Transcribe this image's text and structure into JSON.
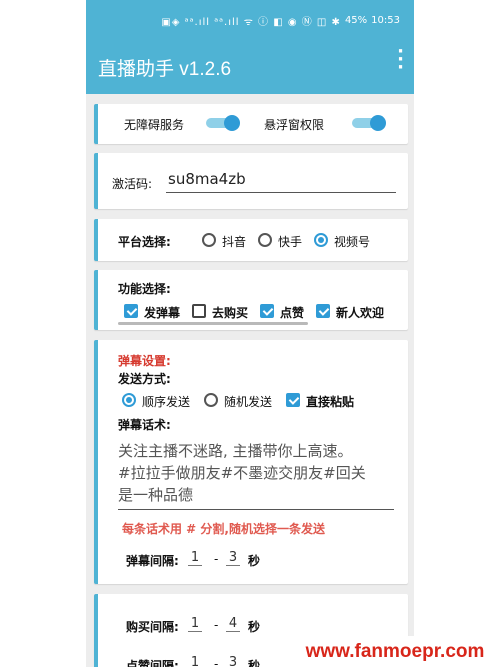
{
  "status_bar": {
    "icons": "▣◈ ᵃᵃ.ıll ᵃᵃ.ıll ᯤ ⓘ ◧ ◉ Ⓝ ◫ ✱",
    "battery": "45%",
    "time": "10:53"
  },
  "app_bar": {
    "title": "直播助手 v1.2.6",
    "menu_icon": "more-vert-icon"
  },
  "permissions": {
    "accessibility_label": "无障碍服务",
    "accessibility_on": true,
    "overlay_label": "悬浮窗权限",
    "overlay_on": true
  },
  "activation": {
    "label": "激活码:",
    "value": "su8ma4zb"
  },
  "platform": {
    "label": "平台选择:",
    "options": [
      "抖音",
      "快手",
      "视频号"
    ],
    "selected": "视频号"
  },
  "features": {
    "label": "功能选择:",
    "items": [
      {
        "label": "发弹幕",
        "checked": true
      },
      {
        "label": "去购买",
        "checked": false
      },
      {
        "label": "点赞",
        "checked": true
      },
      {
        "label": "新人欢迎",
        "checked": true
      }
    ]
  },
  "danmu": {
    "title": "弹幕设置:",
    "send_mode_label": "发送方式:",
    "modes": [
      {
        "label": "顺序发送",
        "type": "radio",
        "checked": true
      },
      {
        "label": "随机发送",
        "type": "radio",
        "checked": false
      },
      {
        "label": "直接粘贴",
        "type": "checkbox",
        "checked": true
      }
    ],
    "script_label": "弹幕话术:",
    "script_lines": [
      "关注主播不迷路, 主播带你上高速。",
      "#拉拉手做朋友#不墨迹交朋友#回关",
      "是一种品德"
    ],
    "hint": "每条话术用 # 分割,随机选择一条发送",
    "interval_label": "弹幕间隔:",
    "interval_min": "1",
    "interval_max": "3",
    "interval_unit": "秒"
  },
  "purchase": {
    "interval_label": "购买间隔:",
    "interval_min": "1",
    "interval_max": "4",
    "interval_unit": "秒",
    "like_label": "点赞间隔:",
    "like_min": "1",
    "like_max": "3",
    "like_unit": "秒"
  },
  "watermark": "www.fanmoepr.com",
  "colors": {
    "accent": "#4fb3d4",
    "toggle": "#2f9bd6",
    "hint": "#e05a50",
    "watermark": "#d8261a"
  }
}
